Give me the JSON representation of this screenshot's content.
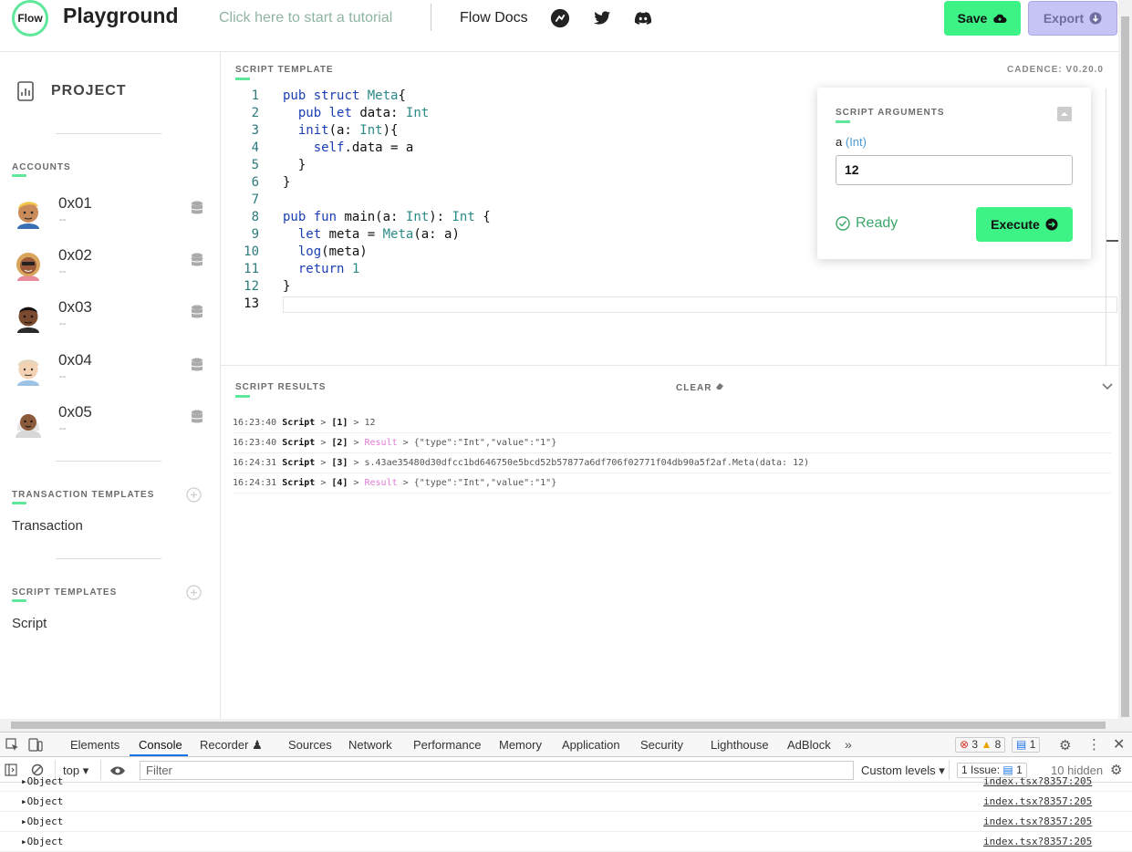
{
  "header": {
    "logo": "Flow",
    "title": "Playground",
    "tutorial_link": "Click here to start a tutorial",
    "docs_link": "Flow Docs",
    "social_icons": [
      "flow-runner-icon",
      "twitter-icon",
      "discord-icon"
    ],
    "save_label": "Save",
    "export_label": "Export"
  },
  "sidebar": {
    "project_label": "PROJECT",
    "accounts_label": "ACCOUNTS",
    "accounts": [
      {
        "name": "0x01",
        "sub": "--"
      },
      {
        "name": "0x02",
        "sub": "--"
      },
      {
        "name": "0x03",
        "sub": "--"
      },
      {
        "name": "0x04",
        "sub": "--"
      },
      {
        "name": "0x05",
        "sub": "--"
      }
    ],
    "transaction_templates_label": "TRANSACTION TEMPLATES",
    "transaction_item": "Transaction",
    "script_templates_label": "SCRIPT TEMPLATES",
    "script_item": "Script"
  },
  "editor": {
    "label": "SCRIPT TEMPLATE",
    "version": "CADENCE: V0.20.0",
    "lines": [
      "pub struct Meta{",
      "  pub let data: Int",
      "  init(a: Int){",
      "    self.data = a",
      "  }",
      "}",
      "",
      "pub fun main(a: Int): Int {",
      "  let meta = Meta(a: a)",
      "  log(meta)",
      "  return 1",
      "}",
      ""
    ]
  },
  "args": {
    "label": "SCRIPT ARGUMENTS",
    "arg_name": "a",
    "arg_type": "(Int)",
    "arg_value": "12",
    "status": "Ready",
    "execute_label": "Execute"
  },
  "results": {
    "label": "SCRIPT RESULTS",
    "clear_label": "CLEAR",
    "rows": [
      {
        "time": "16:23:40",
        "src": "Script",
        "idx": "[1]",
        "kind": "",
        "value": "12"
      },
      {
        "time": "16:23:40",
        "src": "Script",
        "idx": "[2]",
        "kind": "Result",
        "value": "{\"type\":\"Int\",\"value\":\"1\"}"
      },
      {
        "time": "16:24:31",
        "src": "Script",
        "idx": "[3]",
        "kind": "",
        "value": "s.43ae35480d30dfcc1bd646750e5bcd52b57877a6df706f02771f04db90a5f2af.Meta(data: 12)"
      },
      {
        "time": "16:24:31",
        "src": "Script",
        "idx": "[4]",
        "kind": "Result",
        "value": "{\"type\":\"Int\",\"value\":\"1\"}"
      }
    ]
  },
  "devtools": {
    "tabs": [
      "Elements",
      "Console",
      "Recorder",
      "Sources",
      "Network",
      "Performance",
      "Memory",
      "Application",
      "Security",
      "Lighthouse",
      "AdBlock"
    ],
    "active_tab": "Console",
    "errors": "3",
    "warnings": "8",
    "messages": "1",
    "context": "top",
    "filter_placeholder": "Filter",
    "levels": "Custom levels",
    "issues": "1 Issue:",
    "issues_count": "1",
    "hidden": "10 hidden",
    "console_rows": [
      {
        "text": "Object",
        "src": "index.tsx?8357:205"
      },
      {
        "text": "Object",
        "src": "index.tsx?8357:205"
      },
      {
        "text": "Object",
        "src": "index.tsx?8357:205"
      },
      {
        "text": "Object",
        "src": "index.tsx?8357:205"
      }
    ]
  },
  "colors": {
    "accent_green": "#3df386",
    "export_purple": "#c6c4f5",
    "result_pink": "#e27ad6",
    "keyword_blue": "#1a3fb3",
    "type_teal": "#2b8a87"
  }
}
